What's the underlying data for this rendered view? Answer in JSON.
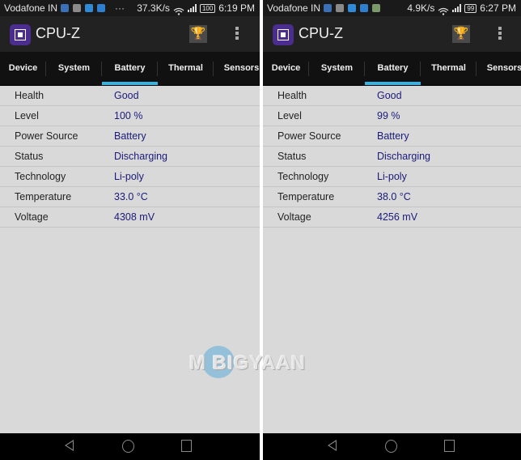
{
  "screens": [
    {
      "status_bar": {
        "carrier": "Vodafone IN",
        "more_indicator": "···",
        "net_speed": "37.3K/s",
        "battery": "100",
        "time": "6:19 PM",
        "notif_colors": [
          "#3b6fb6",
          "#8a8a8a",
          "#2f8ad8",
          "#2f7fd0"
        ]
      },
      "app_bar": {
        "title": "CPU-Z",
        "trophy_icon": "🏆"
      },
      "tabs": [
        {
          "label": "Device"
        },
        {
          "label": "System"
        },
        {
          "label": "Battery",
          "active": true
        },
        {
          "label": "Thermal"
        },
        {
          "label": "Sensors"
        }
      ],
      "rows": [
        {
          "label": "Health",
          "value": "Good"
        },
        {
          "label": "Level",
          "value": "100 %"
        },
        {
          "label": "Power Source",
          "value": "Battery"
        },
        {
          "label": "Status",
          "value": "Discharging"
        },
        {
          "label": "Technology",
          "value": "Li-poly"
        },
        {
          "label": "Temperature",
          "value": "33.0 °C"
        },
        {
          "label": "Voltage",
          "value": "4308 mV"
        }
      ]
    },
    {
      "status_bar": {
        "carrier": "Vodafone IN",
        "more_indicator": "",
        "net_speed": "4.9K/s",
        "battery": "99",
        "time": "6:27 PM",
        "notif_colors": [
          "#3b6fb6",
          "#8a8a8a",
          "#2f8ad8",
          "#2f7fd0",
          "#7a9a6a"
        ]
      },
      "app_bar": {
        "title": "CPU-Z",
        "trophy_icon": "🏆"
      },
      "tabs": [
        {
          "label": "Device"
        },
        {
          "label": "System"
        },
        {
          "label": "Battery",
          "active": true
        },
        {
          "label": "Thermal"
        },
        {
          "label": "Sensors"
        }
      ],
      "rows": [
        {
          "label": "Health",
          "value": "Good"
        },
        {
          "label": "Level",
          "value": "99 %"
        },
        {
          "label": "Power Source",
          "value": "Battery"
        },
        {
          "label": "Status",
          "value": "Discharging"
        },
        {
          "label": "Technology",
          "value": "Li-poly"
        },
        {
          "label": "Temperature",
          "value": "38.0 °C"
        },
        {
          "label": "Voltage",
          "value": "4256 mV"
        }
      ]
    }
  ],
  "watermark": {
    "text": "M BIGYAAN"
  },
  "colors": {
    "accent": "#33b5e5",
    "value_text": "#1a1a7a",
    "app_icon": "#4a2d8c"
  }
}
